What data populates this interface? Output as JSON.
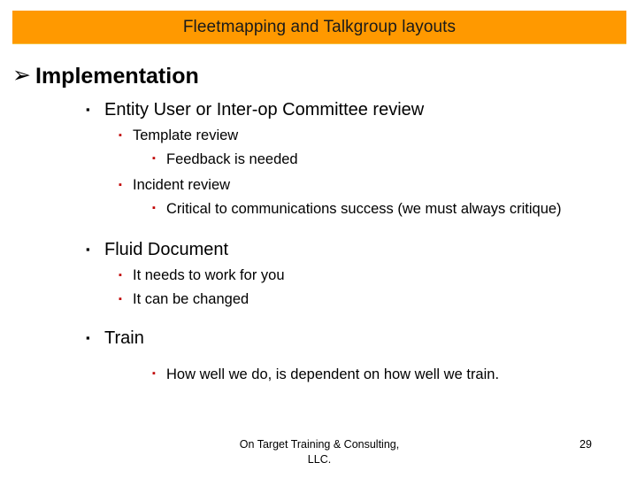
{
  "slide": {
    "title": "Fleetmapping and Talkgroup layouts",
    "title_bar_color": "#FF9900",
    "background_color": "#FFFFFF"
  },
  "bullets": {
    "level1_glyph": "➢",
    "level2_glyph": "▪",
    "level3_glyph": "▪",
    "level4_glyph": "▪",
    "level1_color": "#000000",
    "level2_color": "#000000",
    "level3_color": "#C00000",
    "level4_color": "#C00000"
  },
  "outline": [
    {
      "level": 1,
      "text": "Implementation"
    },
    {
      "level": 2,
      "text": "Entity User or Inter-op Committee review"
    },
    {
      "level": 3,
      "text": "Template review"
    },
    {
      "level": 4,
      "text": "Feedback is needed"
    },
    {
      "level": 3,
      "text": "Incident review"
    },
    {
      "level": 4,
      "text": "Critical to communications success (we must always critique)"
    },
    {
      "level": 2,
      "text": "Fluid Document"
    },
    {
      "level": 3,
      "text": "It needs to work for you"
    },
    {
      "level": 3,
      "text": "It can be changed"
    },
    {
      "level": 2,
      "text": "Train"
    },
    {
      "level": 4,
      "text": "How well we do, is dependent on how well we train."
    }
  ],
  "footer": {
    "credit_line1": "On Target Training & Consulting,",
    "credit_line2": "LLC.",
    "page_number": "29"
  }
}
